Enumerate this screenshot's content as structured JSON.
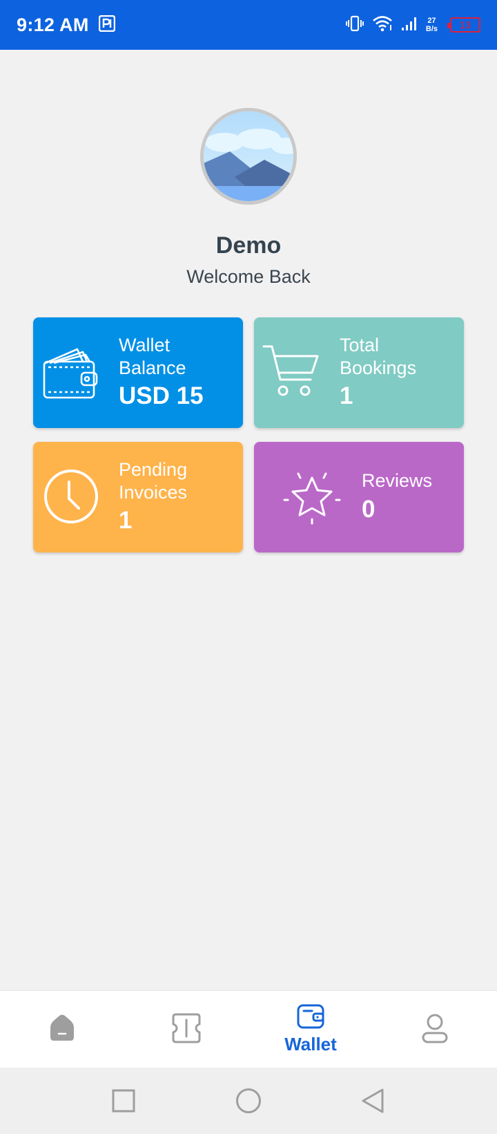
{
  "status_bar": {
    "time": "9:12 AM",
    "net_speed_value": "27",
    "net_speed_unit": "B/s",
    "battery": "13"
  },
  "profile": {
    "name": "Demo",
    "greeting": "Welcome Back"
  },
  "cards": {
    "wallet": {
      "label_line1": "Wallet",
      "label_line2": "Balance",
      "value": "USD 15",
      "color": "#0290e6"
    },
    "bookings": {
      "label_line1": "Total",
      "label_line2": "Bookings",
      "value": "1",
      "color": "#80cbc4"
    },
    "invoices": {
      "label_line1": "Pending",
      "label_line2": "Invoices",
      "value": "1",
      "color": "#ffb34b"
    },
    "reviews": {
      "label": "Reviews",
      "value": "0",
      "color": "#ba68c8"
    }
  },
  "bottom_nav": {
    "items": [
      {
        "icon": "home-icon",
        "label": ""
      },
      {
        "icon": "ticket-icon",
        "label": ""
      },
      {
        "icon": "wallet-icon",
        "label": "Wallet",
        "active": true
      },
      {
        "icon": "profile-icon",
        "label": ""
      }
    ],
    "active_color": "#1565d8",
    "inactive_color": "#9e9e9e"
  },
  "system_nav": {
    "icons": [
      "recent-apps-icon",
      "home-circle-icon",
      "back-icon"
    ]
  },
  "colors": {
    "status_bar": "#0d62df",
    "background": "#f2f1f2"
  }
}
